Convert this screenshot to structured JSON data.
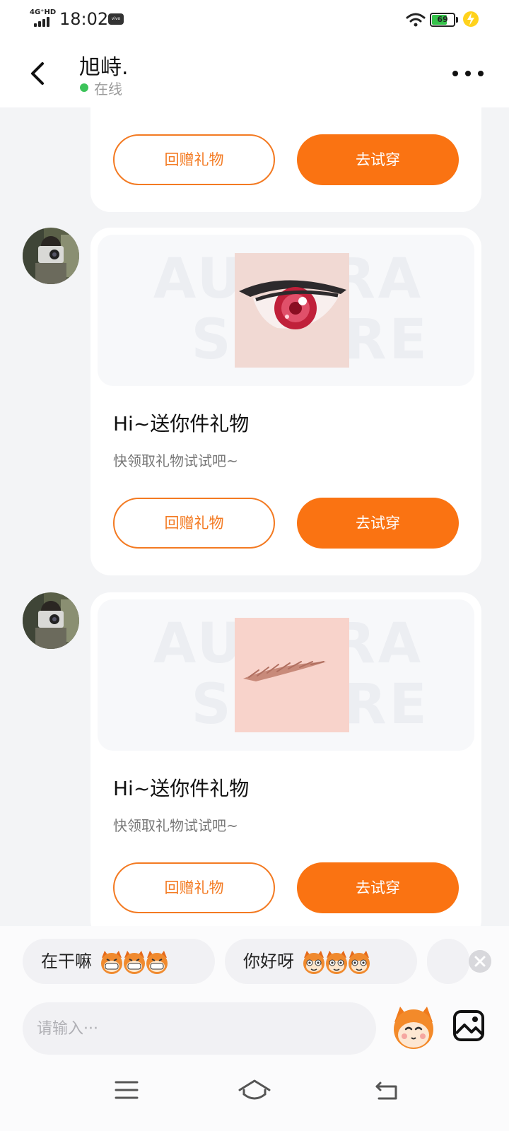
{
  "status_bar": {
    "network": "4G⁺HD",
    "time": "18:02",
    "carrier_badge": "vivo",
    "battery_level": "69",
    "battery_fraction": 0.69
  },
  "header": {
    "contact_name": "旭峙.",
    "presence": "在线"
  },
  "cards": [
    {
      "return_gift_label": "回赠礼物",
      "try_on_label": "去试穿"
    },
    {
      "title": "Hi~送你件礼物",
      "subtitle": "快领取礼物试试吧~",
      "return_gift_label": "回赠礼物",
      "try_on_label": "去试穿",
      "gift": "eye-item"
    },
    {
      "title": "Hi~送你件礼物",
      "subtitle": "快领取礼物试试吧~",
      "return_gift_label": "回赠礼物",
      "try_on_label": "去试穿",
      "gift": "eyebrow-item"
    }
  ],
  "quick_replies": [
    {
      "text": "在干嘛",
      "emoji": "grinning-mascot-icon"
    },
    {
      "text": "你好呀",
      "emoji": "smiling-mascot-icon"
    }
  ],
  "composer": {
    "placeholder": "请输入···"
  },
  "colors": {
    "accent": "#fa7312",
    "accent_outline": "#f37a22",
    "online": "#3cc35a",
    "background": "#f3f4f6"
  }
}
